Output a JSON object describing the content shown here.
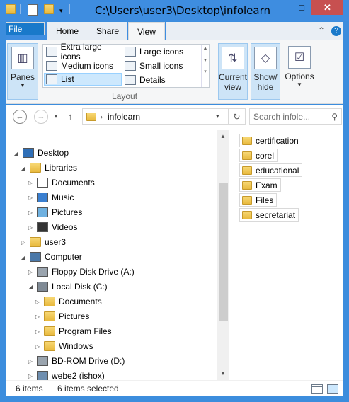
{
  "window": {
    "title": "C:\\Users\\user3\\Desktop\\infolearn",
    "controls": {
      "minimize": "—",
      "maximize": "□",
      "close": "✕"
    },
    "qat_icons": [
      "folder-icon",
      "properties-icon",
      "new-folder-icon",
      "qat-dropdown-icon"
    ]
  },
  "ribbon": {
    "tabs": {
      "file": "File",
      "home": "Home",
      "share": "Share",
      "view": "View"
    },
    "panes_label": "Panes",
    "layout": {
      "options": [
        {
          "label": "Extra large icons",
          "selected": false
        },
        {
          "label": "Large icons",
          "selected": false
        },
        {
          "label": "Medium icons",
          "selected": false
        },
        {
          "label": "Small icons",
          "selected": false
        },
        {
          "label": "List",
          "selected": true
        },
        {
          "label": "Details",
          "selected": false
        }
      ],
      "group_label": "Layout"
    },
    "current_view": {
      "line1": "Current",
      "line2": "view"
    },
    "show_hide": {
      "line1": "Show/",
      "line2": "hide"
    },
    "options_label": "Options"
  },
  "address": {
    "path": "infolearn",
    "search_placeholder": "Search infole..."
  },
  "tree": [
    {
      "label": "Desktop",
      "icon": "desktop-icon",
      "expanded": true
    },
    {
      "label": "Libraries",
      "icon": "libraries-icon",
      "expanded": true
    },
    {
      "label": "Documents",
      "icon": "documents-icon",
      "expanded": false
    },
    {
      "label": "Music",
      "icon": "music-icon",
      "expanded": false
    },
    {
      "label": "Pictures",
      "icon": "pictures-icon",
      "expanded": false
    },
    {
      "label": "Videos",
      "icon": "videos-icon",
      "expanded": false
    },
    {
      "label": "user3",
      "icon": "user-folder-icon",
      "expanded": false
    },
    {
      "label": "Computer",
      "icon": "computer-icon",
      "expanded": true
    },
    {
      "label": "Floppy Disk Drive (A:)",
      "icon": "floppy-drive-icon",
      "expanded": false
    },
    {
      "label": "Local Disk (C:)",
      "icon": "local-disk-icon",
      "expanded": true
    },
    {
      "label": "Documents",
      "icon": "folder-icon",
      "expanded": false
    },
    {
      "label": "Pictures",
      "icon": "folder-icon",
      "expanded": false
    },
    {
      "label": "Program Files",
      "icon": "folder-icon",
      "expanded": false
    },
    {
      "label": "Windows",
      "icon": "folder-icon",
      "expanded": false
    },
    {
      "label": "BD-ROM Drive (D:)",
      "icon": "bd-rom-icon",
      "expanded": false
    },
    {
      "label": "webe2 (ishox)",
      "icon": "network-drive-icon",
      "expanded": false
    }
  ],
  "files": [
    {
      "label": "certification"
    },
    {
      "label": "corel"
    },
    {
      "label": "educational"
    },
    {
      "label": "Exam"
    },
    {
      "label": "Files"
    },
    {
      "label": "secretariat"
    }
  ],
  "status": {
    "item_count": "6 items",
    "selected_count": "6 items selected"
  },
  "colors": {
    "title_bar": "#3e8de0",
    "file_tab": "#1979ca",
    "close_button": "#c75050",
    "selection": "#cde8fd"
  }
}
